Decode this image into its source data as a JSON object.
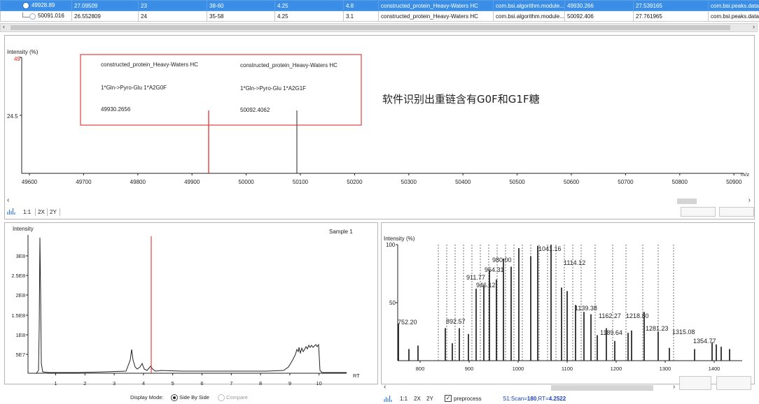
{
  "table": {
    "rows": [
      {
        "selected": true,
        "cells": [
          "49928.89",
          "27.09509",
          "23",
          "38-60",
          "4.25",
          "4.8",
          "constructed_protein_Heavy-Waters HC",
          "com.bsi.algorithm.module...",
          "49930.266",
          "27.539165",
          "com.bsi.peaks.data"
        ]
      },
      {
        "selected": false,
        "cells": [
          "50091.016",
          "26.552809",
          "24",
          "35-58",
          "4.25",
          "3.1",
          "constructed_protein_Heavy-Waters HC",
          "com.bsi.algorithm.module...",
          "50092.406",
          "27.761965",
          "com.bsi.peaks.data"
        ]
      }
    ]
  },
  "top_chart": {
    "ylabel": "Intensity (%)",
    "xunit": "m/z",
    "ymax_label": "49",
    "ymid_label": "24.5",
    "xticks": [
      "49600",
      "49700",
      "49800",
      "49900",
      "50000",
      "50100",
      "50200",
      "50300",
      "50400",
      "50500",
      "50600",
      "50700",
      "50800",
      "50900"
    ],
    "annotation": {
      "left": {
        "protein": "constructed_protein_Heavy-Waters HC",
        "mod": "1*Gln->Pyro-Glu 1*A2G0F",
        "mass": "49930.2656"
      },
      "right": {
        "protein": "constructed_protein_Heavy-Waters HC",
        "mod": "1*Gln->Pyro-Glu 1*A2G1F",
        "mass": "50092.4062"
      }
    },
    "note": "软件识别出重链含有G0F和G1F糖",
    "toolbar": {
      "ratio": "1:1",
      "x2": "2X",
      "y2": "2Y"
    }
  },
  "chromatogram": {
    "ylabel": "Intensity",
    "sample": "Sample 1",
    "yticks": [
      "3E8",
      "2.5E8",
      "2E8",
      "1.5E8",
      "1E8",
      "5E7"
    ],
    "xticks": [
      "1",
      "2",
      "3",
      "4",
      "5",
      "6",
      "7",
      "8",
      "9",
      "10"
    ],
    "xunit": "RT",
    "display_mode_label": "Display Mode:",
    "mode_side": "Side By Side",
    "mode_compare": "Compare"
  },
  "ms_chart": {
    "ylabel": "Intensity (%)",
    "y100": "100",
    "y50": "50",
    "xticks": [
      "800",
      "900",
      "1000",
      "1100",
      "1200",
      "1300",
      "1400"
    ],
    "peak_labels": [
      "752.20",
      "892.57",
      "911.77",
      "946.12",
      "964.31",
      "980.00",
      "1041.16",
      "1114.12",
      "1139.38",
      "1162.27",
      "1189.64",
      "1218.80",
      "1281.23",
      "1315.08",
      "1354.77"
    ],
    "toolbar": {
      "ratio": "1:1",
      "x2": "2X",
      "y2": "2Y",
      "preprocess": "preprocess",
      "scan_prefix": "S1:Scan=",
      "scan": "180",
      "rt_prefix": ",RT=",
      "rt": "4.2522"
    }
  },
  "colors": {
    "selection": "#3a8ee6",
    "marker": "#e01f1f",
    "annotation_border": "#e04040",
    "scan": "#1a3ec8"
  }
}
